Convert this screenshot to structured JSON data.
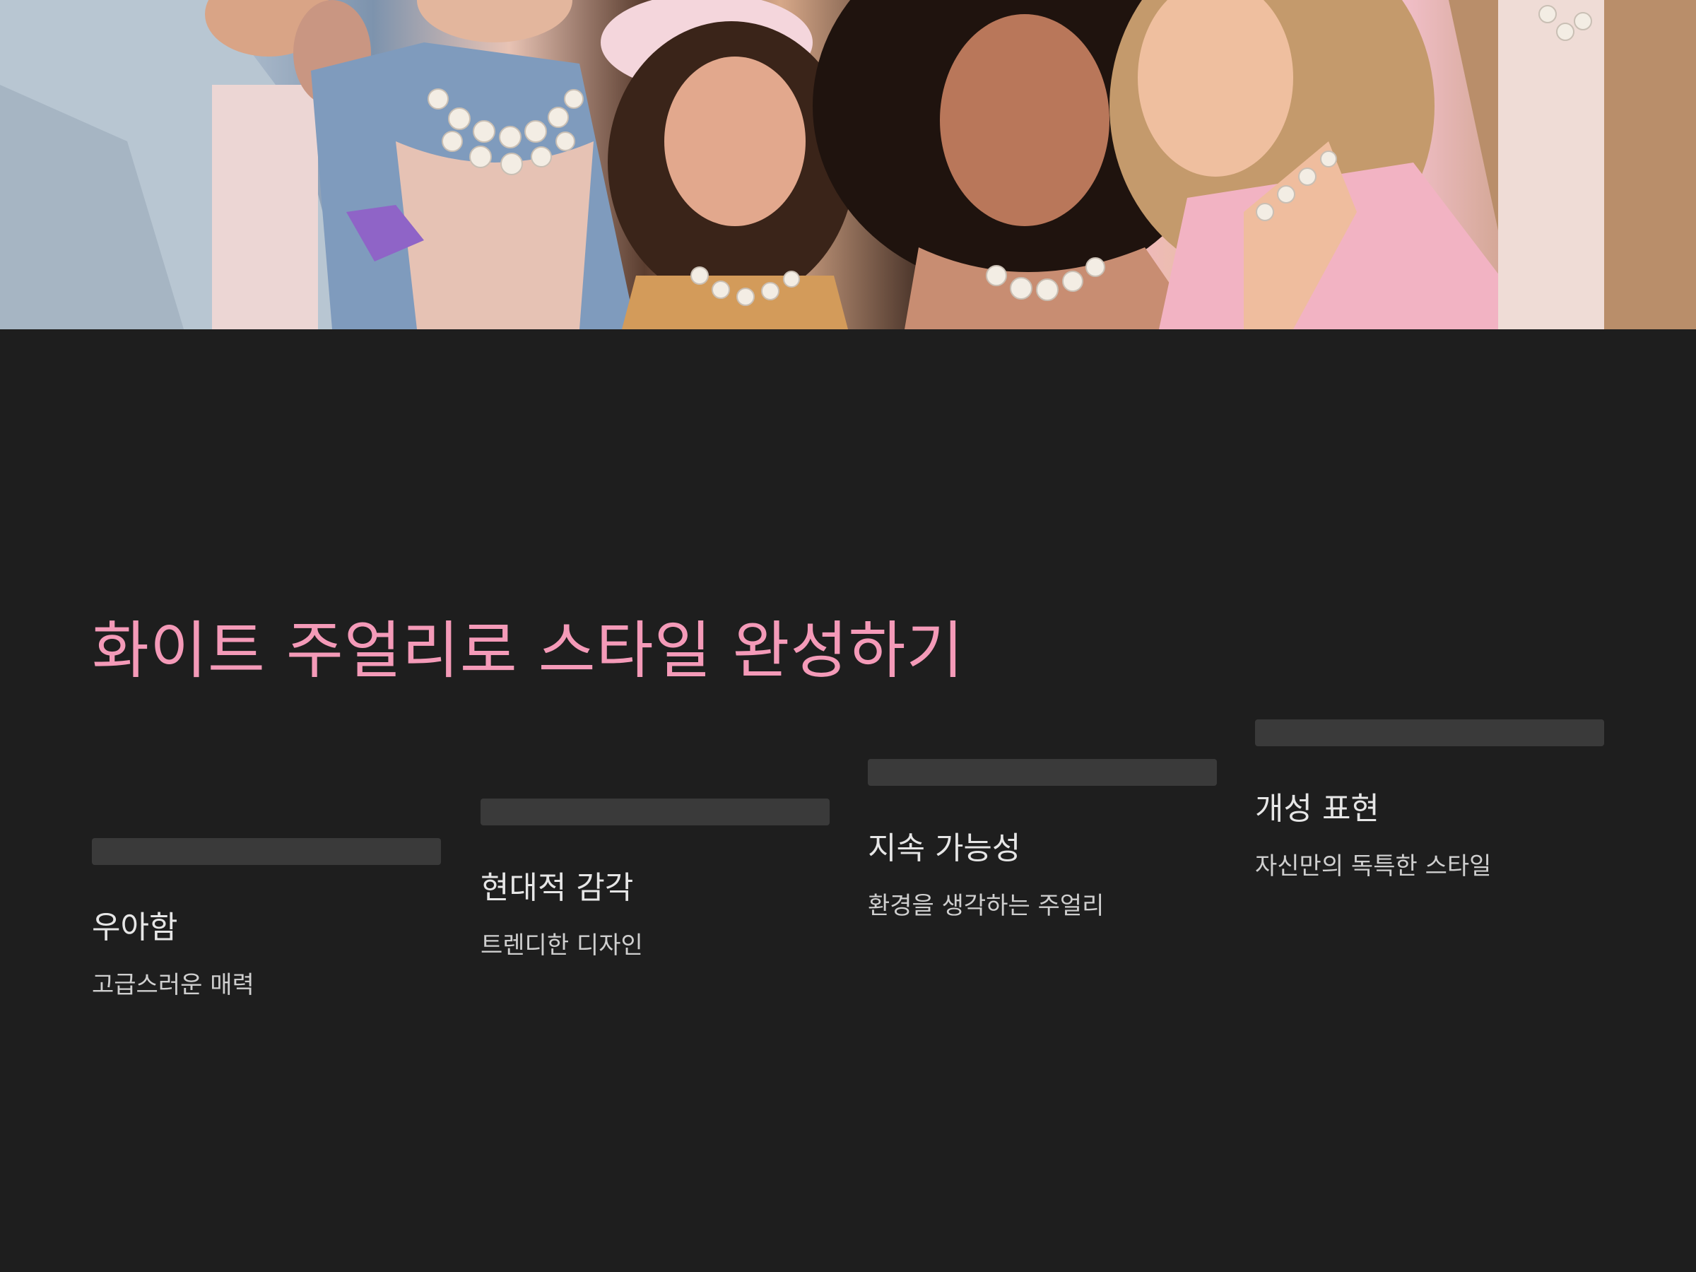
{
  "slide": {
    "title": "화이트 주얼리로 스타일 완성하기",
    "title_color": "#f49ab8",
    "background_color": "#1e1e1e",
    "hero_image": {
      "icon": "photo-fashion-group-pearl-necklaces"
    },
    "steps": [
      {
        "heading": "우아함",
        "description": "고급스러운 매력"
      },
      {
        "heading": "현대적 감각",
        "description": "트렌디한 디자인"
      },
      {
        "heading": "지속 가능성",
        "description": "환경을 생각하는 주얼리"
      },
      {
        "heading": "개성 표현",
        "description": "자신만의 독특한 스타일"
      }
    ]
  }
}
